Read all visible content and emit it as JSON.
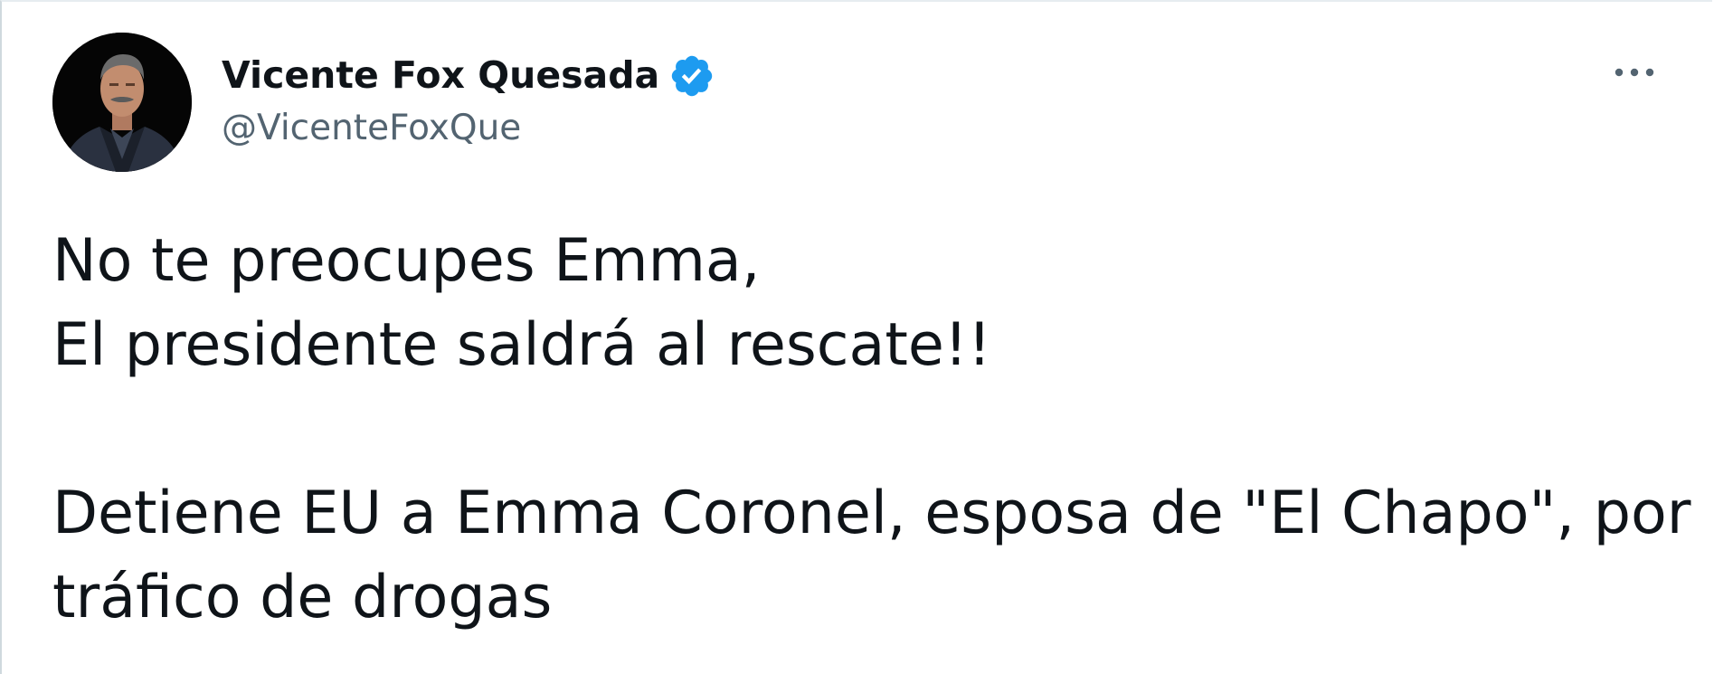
{
  "tweet": {
    "author": {
      "display_name": "Vicente Fox Quesada",
      "handle": "@VicenteFoxQue",
      "verified": true,
      "verified_color": "#1d9bf0",
      "avatar_icon": "profile-photo"
    },
    "more_icon": "more-horizontal-icon",
    "text_lines": [
      "No te preocupes Emma,",
      "El presidente saldrá al rescate!!",
      "",
      "Detiene EU a Emma Coronel, esposa de \"El Chapo\", por",
      "tráfico de drogas"
    ]
  }
}
